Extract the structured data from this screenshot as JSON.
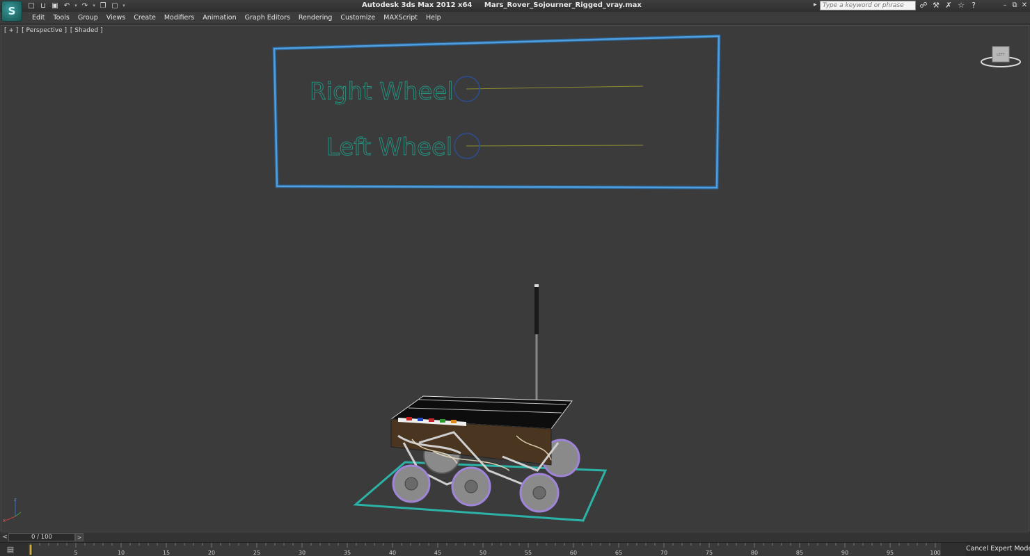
{
  "app": {
    "logo": "S",
    "title": "Autodesk 3ds Max  2012 x64",
    "filename": "Mars_Rover_Sojourner_Rigged_vray.max"
  },
  "quick_access": [
    "new-icon",
    "open-icon",
    "save-icon",
    "undo-icon",
    "redo-icon",
    "project-icon",
    "window-icon"
  ],
  "search": {
    "placeholder": "Type a keyword or phrase"
  },
  "menu": [
    "Edit",
    "Tools",
    "Group",
    "Views",
    "Create",
    "Modifiers",
    "Animation",
    "Graph Editors",
    "Rendering",
    "Customize",
    "MAXScript",
    "Help"
  ],
  "viewport": {
    "labels": [
      "[ + ]",
      "[ Perspective ]",
      "[ Shaded ]"
    ],
    "viewcube_label": "LEFT",
    "axis": {
      "z": "z",
      "x": "x"
    }
  },
  "rig_panel": {
    "right_label": "Right Wheel",
    "left_label": "Left Wheel",
    "colors": {
      "frame": "#3f8fd2",
      "text": "#1f8a7c",
      "circle": "#2b4a8a",
      "track": "#8a8a2a"
    }
  },
  "timeline": {
    "frame_display": "0 / 100",
    "ticks": [
      "5",
      "10",
      "15",
      "20",
      "25",
      "30",
      "35",
      "40",
      "45",
      "50",
      "55",
      "60",
      "65",
      "70",
      "75",
      "80",
      "85",
      "90",
      "95",
      "100"
    ],
    "prev": "<",
    "next": ">"
  },
  "status": {
    "cancel_expert": "Cancel Expert Mode"
  }
}
